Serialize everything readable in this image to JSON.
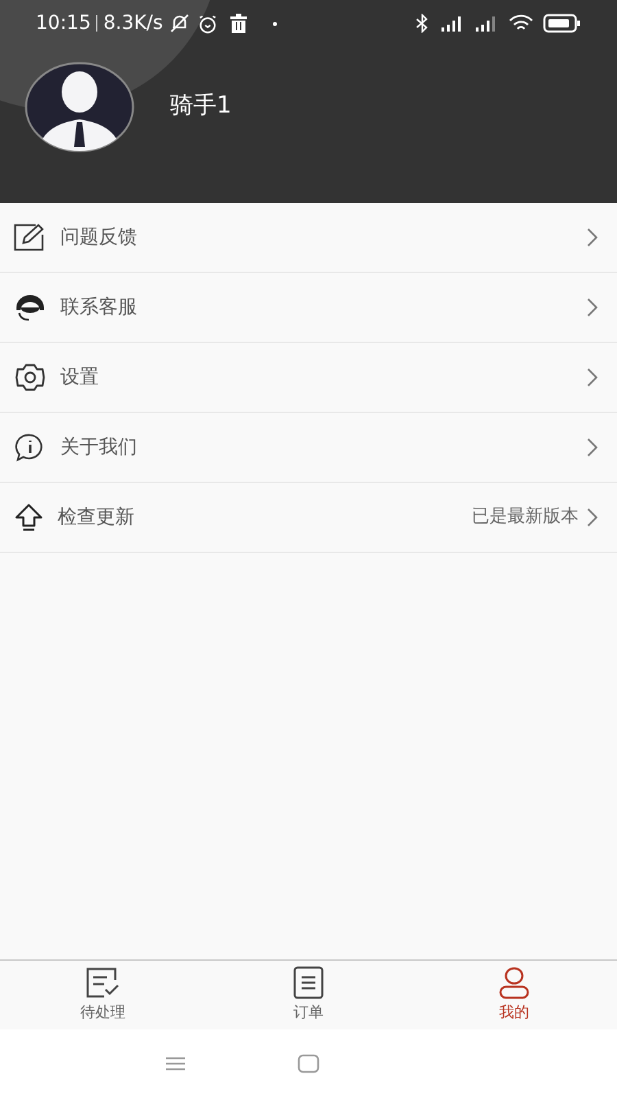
{
  "status_bar": {
    "time": "10:15",
    "speed": "8.3K/s"
  },
  "profile": {
    "name": "骑手1"
  },
  "menu": [
    {
      "label": "问题反馈"
    },
    {
      "label": "联系客服"
    },
    {
      "label": "设置"
    },
    {
      "label": "关于我们"
    },
    {
      "label": "检查更新",
      "value": "已是最新版本"
    }
  ],
  "tabs": [
    {
      "label": "待处理",
      "selected": false
    },
    {
      "label": "订单",
      "selected": false
    },
    {
      "label": "我的",
      "selected": true
    }
  ]
}
